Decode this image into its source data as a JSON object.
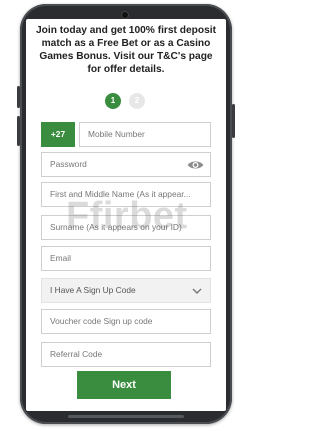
{
  "promo": {
    "text": "Join today and get 100% first deposit match as a Free Bet or as a Casino Games Bonus. Visit our T&C's page for offer details."
  },
  "steps": {
    "current": "1",
    "next": "2"
  },
  "phone": {
    "prefix": "+27",
    "placeholder": "Mobile Number"
  },
  "password": {
    "placeholder": "Password"
  },
  "first_name": {
    "placeholder": "First and Middle Name (As it appear..."
  },
  "surname": {
    "placeholder": "Surname (As it appears on your ID)"
  },
  "email": {
    "placeholder": "Email"
  },
  "signup_code_select": {
    "value": "I Have A Sign Up Code"
  },
  "voucher": {
    "placeholder": "Voucher code Sign up code"
  },
  "referral": {
    "placeholder": "Referral Code"
  },
  "next_button": {
    "label": "Next"
  },
  "watermark": {
    "text": "Ffirbet"
  },
  "colors": {
    "brand_green": "#3a8d3f",
    "phone_body": "#2a2c2f"
  },
  "icons": [
    "eye-icon",
    "chevron-down-icon",
    "camera-icon"
  ]
}
